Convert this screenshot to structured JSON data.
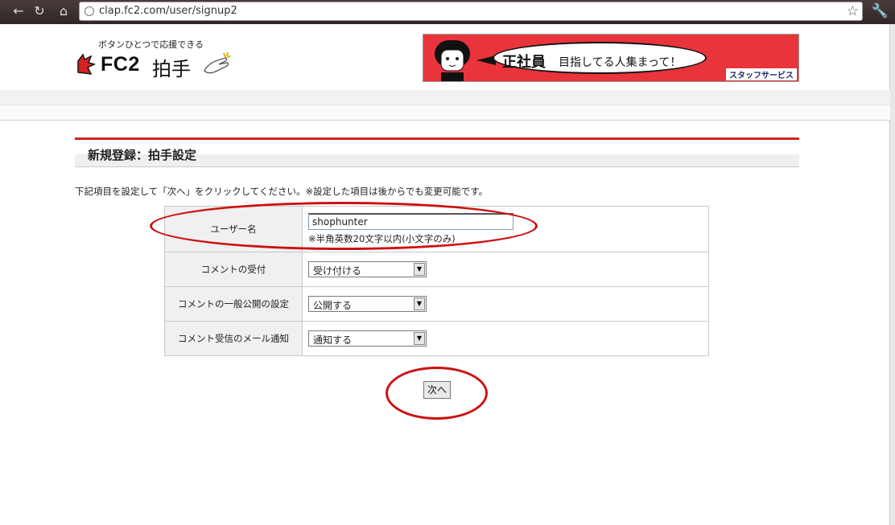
{
  "browser": {
    "url": "clap.fc2.com/user/signup2"
  },
  "header": {
    "tagline": "ボタンひとつで応援できる",
    "logo_text": "FC2",
    "logo_jp": "拍手"
  },
  "banner": {
    "headline": "正社員",
    "text": "目指してる人集まって！",
    "brand": "スタッフサービス"
  },
  "page": {
    "title": "新規登録：拍手設定",
    "intro": "下記項目を設定して「次へ」をクリックしてください。※設定した項目は後からでも変更可能です。"
  },
  "form": {
    "username": {
      "label": "ユーザー名",
      "value": "shophunter",
      "note": "※半角英数20文字以内(小文字のみ)"
    },
    "comment_accept": {
      "label": "コメントの受付",
      "selected": "受け付ける"
    },
    "comment_public": {
      "label": "コメントの一般公開の設定",
      "selected": "公開する"
    },
    "comment_mail": {
      "label": "コメント受信のメール通知",
      "selected": "通知する"
    },
    "next_label": "次へ"
  },
  "colors": {
    "accent_red": "#d42222",
    "annotation_red": "#cc1111"
  }
}
